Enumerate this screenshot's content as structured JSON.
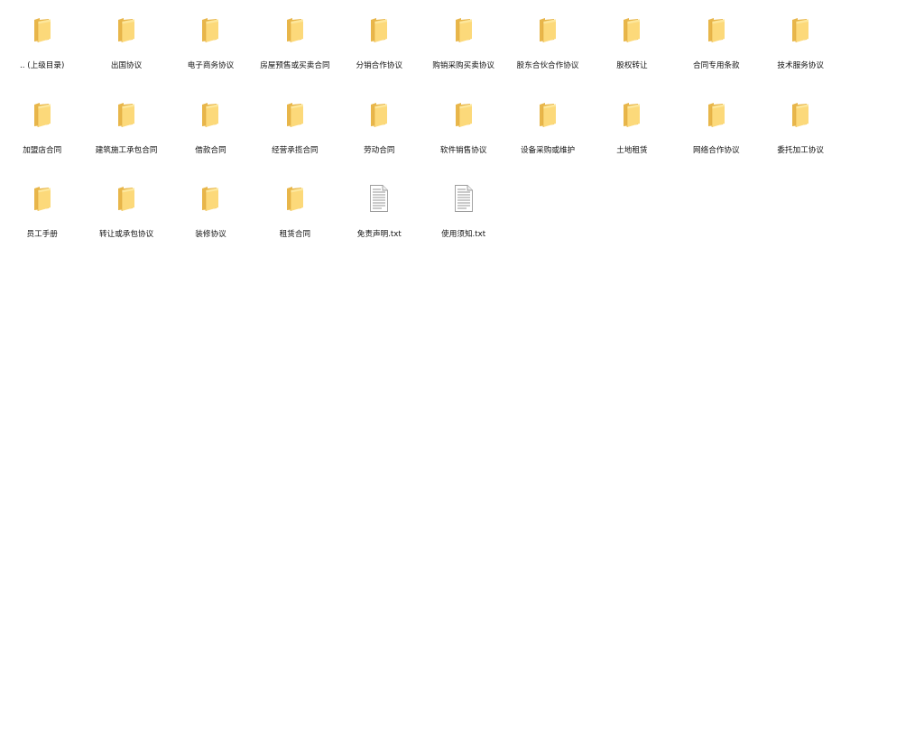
{
  "items": [
    {
      "label": ".. (上级目录)",
      "icon": "folder-icon"
    },
    {
      "label": "出国协议",
      "icon": "folder-icon"
    },
    {
      "label": "电子商务协议",
      "icon": "folder-icon"
    },
    {
      "label": "房屋预售或买卖合同",
      "icon": "folder-icon"
    },
    {
      "label": "分销合作协议",
      "icon": "folder-icon"
    },
    {
      "label": "购销采购买卖协议",
      "icon": "folder-icon"
    },
    {
      "label": "股东合伙合作协议",
      "icon": "folder-icon"
    },
    {
      "label": "股权转让",
      "icon": "folder-icon"
    },
    {
      "label": "合同专用条款",
      "icon": "folder-icon"
    },
    {
      "label": "技术服务协议",
      "icon": "folder-icon"
    },
    {
      "label": "加盟店合同",
      "icon": "folder-icon"
    },
    {
      "label": "建筑施工承包合同",
      "icon": "folder-icon"
    },
    {
      "label": "借款合同",
      "icon": "folder-icon"
    },
    {
      "label": "经营承揽合同",
      "icon": "folder-icon"
    },
    {
      "label": "劳动合同",
      "icon": "folder-icon"
    },
    {
      "label": "软件销售协议",
      "icon": "folder-icon"
    },
    {
      "label": "设备采购或维护",
      "icon": "folder-icon"
    },
    {
      "label": "土地租赁",
      "icon": "folder-icon"
    },
    {
      "label": "网络合作协议",
      "icon": "folder-icon"
    },
    {
      "label": "委托加工协议",
      "icon": "folder-icon"
    },
    {
      "label": "员工手册",
      "icon": "folder-icon"
    },
    {
      "label": "转让或承包协议",
      "icon": "folder-icon"
    },
    {
      "label": "装修协议",
      "icon": "folder-icon"
    },
    {
      "label": "租赁合同",
      "icon": "folder-icon"
    },
    {
      "label": "免责声明.txt",
      "icon": "text-file-icon"
    },
    {
      "label": "使用须知.txt",
      "icon": "text-file-icon"
    }
  ],
  "colors": {
    "folder_back": "#e8b64a",
    "folder_front": "#fcd97a",
    "folder_highlight": "#fde79c",
    "file_body": "#ffffff",
    "file_border": "#9a9a9a",
    "file_lines": "#8c8c8c"
  }
}
